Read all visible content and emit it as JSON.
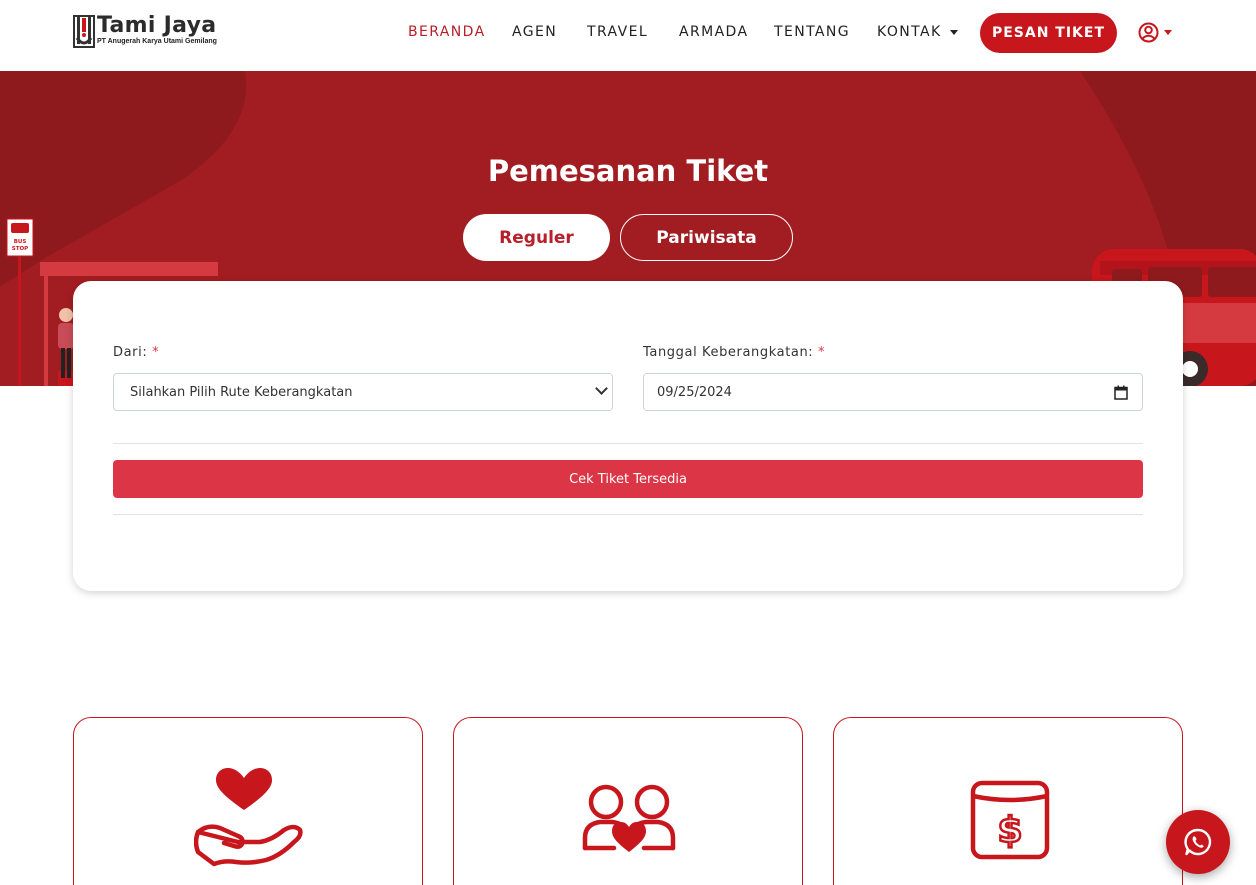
{
  "brand": {
    "name": "Tami Jaya",
    "subtitle": "PT Anugerah Karya Utami Gemilang",
    "logo_icon": "tami-jaya-logo"
  },
  "nav": {
    "items": [
      {
        "label": "BERANDA",
        "active": true
      },
      {
        "label": "AGEN",
        "active": false
      },
      {
        "label": "TRAVEL",
        "active": false
      },
      {
        "label": "ARMADA",
        "active": false
      },
      {
        "label": "TENTANG",
        "active": false
      },
      {
        "label": "KONTAK",
        "active": false,
        "dropdown": true
      }
    ],
    "cta_label": "PESAN TIKET",
    "user_icon": "user-circle-icon"
  },
  "hero": {
    "title": "Pemesanan Tiket",
    "tabs": [
      {
        "label": "Reguler",
        "selected": true
      },
      {
        "label": "Pariwisata",
        "selected": false
      }
    ],
    "bus_stop_sign": "BUS STOP"
  },
  "form": {
    "from_label": "Dari:",
    "from_required": "*",
    "from_value": "Silahkan Pilih Rute Keberangkatan",
    "date_label": "Tanggal Keberangkatan:",
    "date_required": "*",
    "date_value": "09/25/2024",
    "submit_label": "Cek Tiket Tersedia"
  },
  "features": [
    {
      "icon": "hand-heart-icon"
    },
    {
      "icon": "couple-heart-icon"
    },
    {
      "icon": "dollar-wallet-icon"
    }
  ],
  "floating": {
    "icon": "whatsapp-icon"
  },
  "colors": {
    "primary": "#c8161d",
    "hero_bg": "#a21d21",
    "button": "#dc3545"
  }
}
